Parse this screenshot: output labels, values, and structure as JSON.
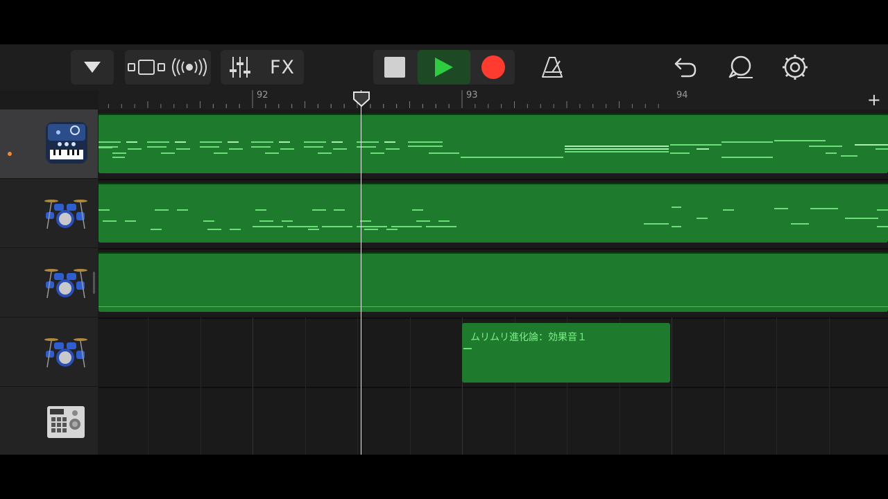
{
  "toolbar": {
    "fx_label": "FX",
    "icons": [
      "tracks-dropdown-icon",
      "view-toggle-icon",
      "live-loops-icon",
      "mixer-icon",
      "fx-button",
      "stop-icon",
      "play-icon",
      "record-icon",
      "metronome-icon",
      "undo-icon",
      "loop-browser-icon",
      "settings-icon"
    ]
  },
  "ruler": {
    "bars": [
      "92",
      "93",
      "94"
    ],
    "add_label": "+"
  },
  "tracks": [
    {
      "instrument": "synth-keyboard-icon",
      "selected": true
    },
    {
      "instrument": "drum-kit-icon",
      "selected": false
    },
    {
      "instrument": "drum-kit-icon",
      "selected": false
    },
    {
      "instrument": "drum-kit-icon",
      "selected": false
    },
    {
      "instrument": "beat-sequencer-icon",
      "selected": false
    }
  ],
  "regions": {
    "effect_region_label": "ムリムリ進化論：効果音１"
  },
  "colors": {
    "region_green": "#1e7a2c",
    "note_green": "#6ee07a",
    "record_red": "#ff3b30",
    "play_green": "#2ecc40"
  }
}
